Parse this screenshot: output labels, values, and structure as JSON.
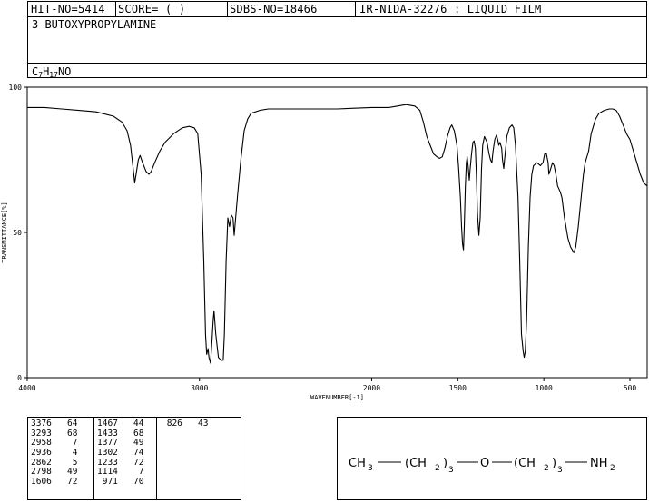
{
  "header": {
    "hit_no": "HIT-NO=5414",
    "score": "SCORE=  (   )",
    "sdbs_no": "SDBS-NO=18466",
    "ir_info": "IR-NIDA-32276 : LIQUID FILM",
    "compound_name": "3-BUTOXYPROPYLAMINE",
    "formula": {
      "c": "C",
      "c_n": "7",
      "h": "H",
      "h_n": "17",
      "rest": "NO"
    }
  },
  "chart_data": {
    "type": "line",
    "title": "",
    "xlabel": "WAVENUMBER[-1]",
    "ylabel": "TRANSMITTANCE[%]",
    "xlim": [
      4000,
      400
    ],
    "ylim": [
      0,
      100
    ],
    "x_ticks": [
      4000,
      3000,
      2000,
      1500,
      1000,
      500
    ],
    "x_tick_labels": [
      "4000",
      "3000",
      "2000",
      "1500",
      "1000",
      "500"
    ],
    "y_ticks": [
      0,
      50,
      100
    ],
    "y_tick_labels": [
      "0",
      "50",
      "100"
    ],
    "grid": false,
    "series": [
      {
        "points": [
          [
            4000,
            93
          ],
          [
            3900,
            93
          ],
          [
            3800,
            92.5
          ],
          [
            3700,
            92
          ],
          [
            3600,
            91.5
          ],
          [
            3500,
            90
          ],
          [
            3450,
            88
          ],
          [
            3420,
            85
          ],
          [
            3400,
            80
          ],
          [
            3385,
            72
          ],
          [
            3376,
            67
          ],
          [
            3368,
            70
          ],
          [
            3355,
            75
          ],
          [
            3345,
            76.5
          ],
          [
            3330,
            74
          ],
          [
            3310,
            71
          ],
          [
            3293,
            70
          ],
          [
            3280,
            71
          ],
          [
            3260,
            74
          ],
          [
            3230,
            78
          ],
          [
            3200,
            81
          ],
          [
            3150,
            84
          ],
          [
            3100,
            86
          ],
          [
            3060,
            86.5
          ],
          [
            3030,
            86
          ],
          [
            3010,
            84
          ],
          [
            2990,
            70
          ],
          [
            2975,
            40
          ],
          [
            2965,
            15
          ],
          [
            2958,
            8
          ],
          [
            2950,
            10
          ],
          [
            2945,
            7
          ],
          [
            2936,
            5
          ],
          [
            2928,
            12
          ],
          [
            2920,
            20
          ],
          [
            2915,
            23
          ],
          [
            2905,
            15
          ],
          [
            2890,
            7
          ],
          [
            2875,
            6
          ],
          [
            2862,
            6
          ],
          [
            2855,
            15
          ],
          [
            2845,
            40
          ],
          [
            2835,
            55
          ],
          [
            2825,
            52
          ],
          [
            2815,
            56
          ],
          [
            2805,
            55
          ],
          [
            2798,
            49
          ],
          [
            2790,
            55
          ],
          [
            2780,
            62
          ],
          [
            2760,
            75
          ],
          [
            2740,
            85
          ],
          [
            2720,
            89
          ],
          [
            2700,
            91
          ],
          [
            2650,
            92
          ],
          [
            2600,
            92.5
          ],
          [
            2400,
            92.5
          ],
          [
            2200,
            92.5
          ],
          [
            2000,
            93
          ],
          [
            1900,
            93
          ],
          [
            1850,
            93.5
          ],
          [
            1800,
            94
          ],
          [
            1750,
            93.5
          ],
          [
            1720,
            92
          ],
          [
            1700,
            88
          ],
          [
            1680,
            83
          ],
          [
            1660,
            80
          ],
          [
            1640,
            77
          ],
          [
            1620,
            76
          ],
          [
            1606,
            75.5
          ],
          [
            1590,
            76
          ],
          [
            1575,
            79
          ],
          [
            1560,
            83
          ],
          [
            1545,
            86
          ],
          [
            1535,
            87
          ],
          [
            1520,
            85
          ],
          [
            1505,
            80
          ],
          [
            1495,
            72
          ],
          [
            1485,
            62
          ],
          [
            1478,
            52
          ],
          [
            1472,
            46
          ],
          [
            1467,
            44
          ],
          [
            1462,
            52
          ],
          [
            1456,
            66
          ],
          [
            1450,
            74
          ],
          [
            1445,
            76
          ],
          [
            1440,
            73
          ],
          [
            1433,
            68
          ],
          [
            1428,
            72
          ],
          [
            1420,
            77
          ],
          [
            1412,
            81
          ],
          [
            1405,
            81.5
          ],
          [
            1398,
            79
          ],
          [
            1392,
            70
          ],
          [
            1385,
            56
          ],
          [
            1377,
            49
          ],
          [
            1370,
            55
          ],
          [
            1362,
            72
          ],
          [
            1355,
            80
          ],
          [
            1345,
            83
          ],
          [
            1330,
            81
          ],
          [
            1318,
            77
          ],
          [
            1310,
            75
          ],
          [
            1302,
            74
          ],
          [
            1295,
            78
          ],
          [
            1285,
            82
          ],
          [
            1275,
            83.5
          ],
          [
            1268,
            82
          ],
          [
            1262,
            80
          ],
          [
            1255,
            81
          ],
          [
            1245,
            79
          ],
          [
            1240,
            75
          ],
          [
            1233,
            72
          ],
          [
            1225,
            77
          ],
          [
            1215,
            83
          ],
          [
            1200,
            86
          ],
          [
            1185,
            87
          ],
          [
            1175,
            86
          ],
          [
            1165,
            80
          ],
          [
            1150,
            62
          ],
          [
            1140,
            40
          ],
          [
            1130,
            15
          ],
          [
            1120,
            9
          ],
          [
            1114,
            7
          ],
          [
            1108,
            9
          ],
          [
            1100,
            20
          ],
          [
            1090,
            45
          ],
          [
            1080,
            62
          ],
          [
            1070,
            70
          ],
          [
            1060,
            73
          ],
          [
            1040,
            74
          ],
          [
            1020,
            73
          ],
          [
            1005,
            74
          ],
          [
            995,
            77
          ],
          [
            985,
            77
          ],
          [
            975,
            74
          ],
          [
            971,
            70
          ],
          [
            960,
            72
          ],
          [
            950,
            74
          ],
          [
            940,
            73
          ],
          [
            930,
            70
          ],
          [
            920,
            66
          ],
          [
            905,
            64
          ],
          [
            895,
            62
          ],
          [
            880,
            55
          ],
          [
            860,
            48
          ],
          [
            845,
            45
          ],
          [
            835,
            44
          ],
          [
            826,
            43
          ],
          [
            815,
            45
          ],
          [
            800,
            52
          ],
          [
            790,
            58
          ],
          [
            780,
            64
          ],
          [
            770,
            70
          ],
          [
            760,
            74
          ],
          [
            740,
            78
          ],
          [
            725,
            84
          ],
          [
            700,
            89
          ],
          [
            680,
            91
          ],
          [
            650,
            92
          ],
          [
            620,
            92.5
          ],
          [
            600,
            92.5
          ],
          [
            580,
            92
          ],
          [
            560,
            90
          ],
          [
            540,
            87
          ],
          [
            520,
            84
          ],
          [
            500,
            82
          ],
          [
            480,
            78
          ],
          [
            460,
            74
          ],
          [
            440,
            70
          ],
          [
            420,
            67
          ],
          [
            400,
            66
          ]
        ]
      }
    ]
  },
  "peaks": {
    "columns": [
      [
        [
          "3376",
          "64"
        ],
        [
          "3293",
          "68"
        ],
        [
          "2958",
          "7"
        ],
        [
          "2936",
          "4"
        ],
        [
          "2862",
          "5"
        ],
        [
          "2798",
          "49"
        ],
        [
          "1606",
          "72"
        ]
      ],
      [
        [
          "1467",
          "44"
        ],
        [
          "1433",
          "68"
        ],
        [
          "1377",
          "49"
        ],
        [
          "1302",
          "74"
        ],
        [
          "1233",
          "72"
        ],
        [
          "1114",
          "7"
        ],
        [
          "971",
          "70"
        ]
      ],
      [
        [
          "826",
          "43"
        ]
      ]
    ]
  },
  "structure": {
    "parts": [
      "CH",
      "3",
      "(CH",
      "2",
      ")",
      "3",
      "O",
      "(CH",
      "2",
      ")",
      "3",
      "NH",
      "2"
    ]
  },
  "colors": {
    "line": "#000000",
    "background": "#ffffff"
  }
}
